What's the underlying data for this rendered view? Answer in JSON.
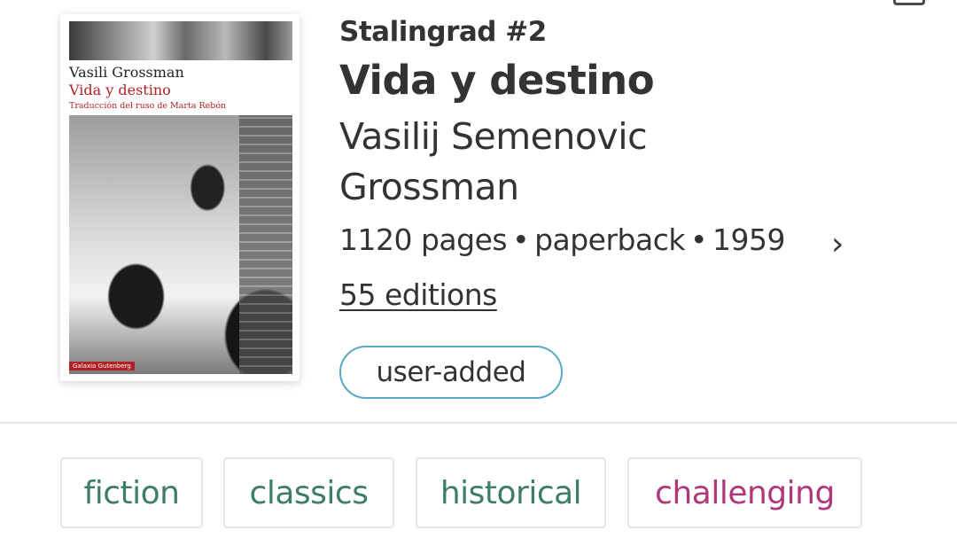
{
  "header": {
    "menu_icon": "tray-icon"
  },
  "cover": {
    "author": "Vasili Grossman",
    "title": "Vida y destino",
    "translation": "Traducción del ruso de Marta Rebón",
    "publisher": "Galaxia Gutenberg"
  },
  "book": {
    "series": "Stalingrad #2",
    "title": "Vida y destino",
    "author": "Vasilij Semenovic Grossman",
    "pages": "1120 pages",
    "format": "paperback",
    "year": "1959",
    "separator": "•",
    "chevron": "›",
    "editions": "55 editions",
    "badge": "user-added"
  },
  "tags": [
    {
      "label": "fiction",
      "color": "#3e7d66"
    },
    {
      "label": "classics",
      "color": "#3e7d66"
    },
    {
      "label": "historical",
      "color": "#3e7d66"
    },
    {
      "label": "challenging",
      "color": "#b0387a"
    }
  ]
}
